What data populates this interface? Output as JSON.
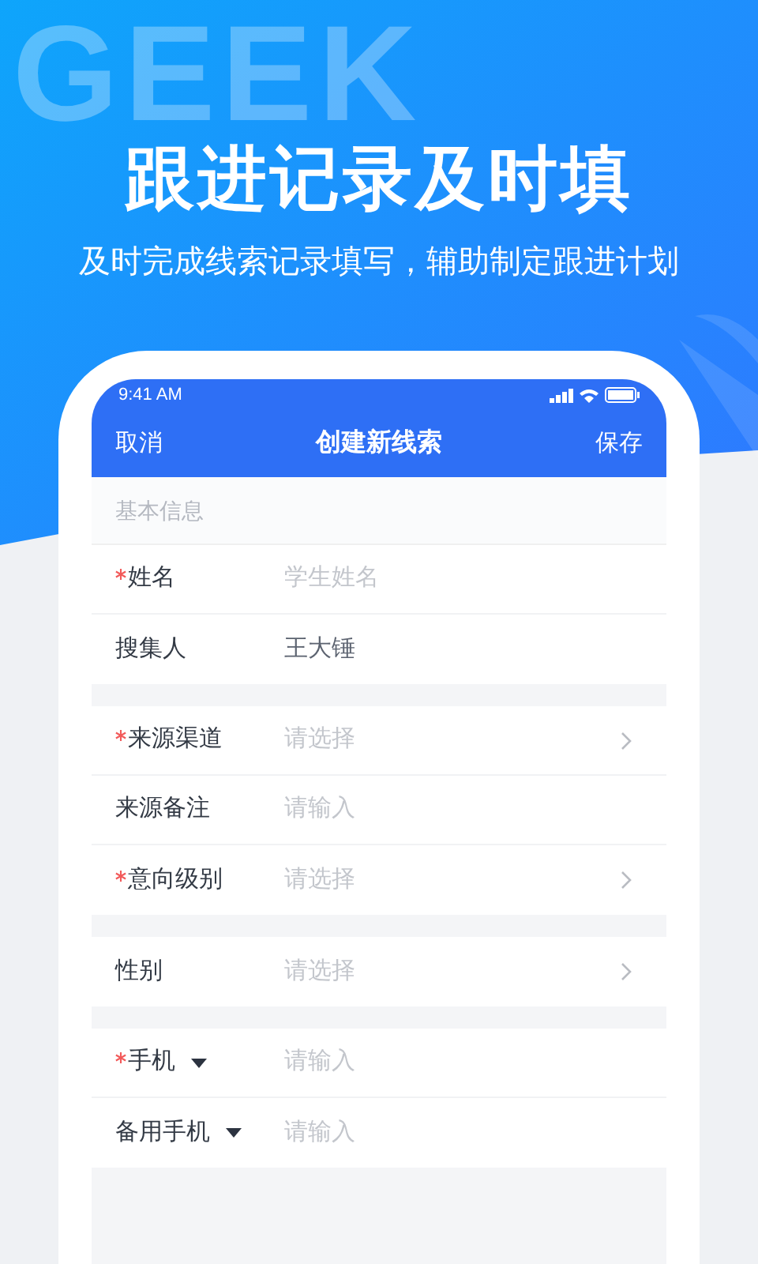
{
  "background_text": "GEEK",
  "headline": "跟进记录及时填",
  "subtitle": "及时完成线索记录填写，辅助制定跟进计划",
  "phone": {
    "status_bar": {
      "time": "9:41 AM"
    },
    "nav": {
      "left": "取消",
      "title": "创建新线索",
      "right": "保存"
    },
    "section_title": "基本信息",
    "groups": [
      [
        {
          "kind": "input",
          "label": "姓名",
          "required": true,
          "placeholder": "学生姓名"
        },
        {
          "kind": "input",
          "label": "搜集人",
          "required": false,
          "value": "王大锤"
        }
      ],
      [
        {
          "kind": "select",
          "label": "来源渠道",
          "required": true,
          "placeholder": "请选择"
        },
        {
          "kind": "input",
          "label": "来源备注",
          "required": false,
          "placeholder": "请输入"
        },
        {
          "kind": "select",
          "label": "意向级别",
          "required": true,
          "placeholder": "请选择"
        }
      ],
      [
        {
          "kind": "select",
          "label": "性别",
          "required": false,
          "placeholder": "请选择"
        }
      ],
      [
        {
          "kind": "dropdown_input",
          "label": "手机",
          "required": true,
          "placeholder": "请输入"
        },
        {
          "kind": "dropdown_input",
          "label": "备用手机",
          "required": false,
          "placeholder": "请输入"
        }
      ]
    ]
  }
}
